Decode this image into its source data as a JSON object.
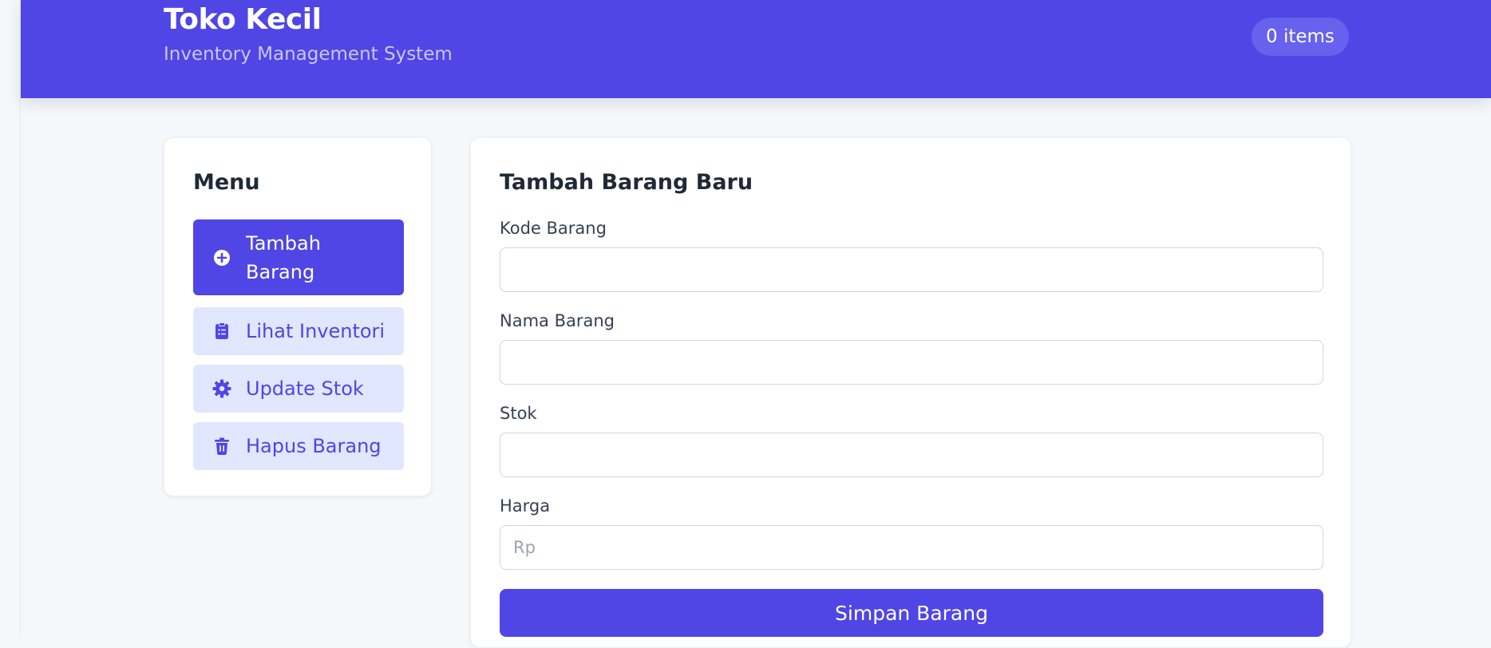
{
  "header": {
    "title": "Toko Kecil",
    "subtitle": "Inventory Management System",
    "item_count": "0 items",
    "brand_color": "#4f46e5"
  },
  "menu": {
    "title": "Menu",
    "items": [
      {
        "label": "Tambah Barang",
        "icon": "plus-circle-icon",
        "active": true
      },
      {
        "label": "Lihat Inventori",
        "icon": "clipboard-list-icon",
        "active": false
      },
      {
        "label": "Update Stok",
        "icon": "gear-icon",
        "active": false
      },
      {
        "label": "Hapus Barang",
        "icon": "trash-icon",
        "active": false
      }
    ]
  },
  "form": {
    "title": "Tambah Barang Baru",
    "fields": [
      {
        "label": "Kode Barang",
        "value": "",
        "placeholder": ""
      },
      {
        "label": "Nama Barang",
        "value": "",
        "placeholder": ""
      },
      {
        "label": "Stok",
        "value": "",
        "placeholder": ""
      },
      {
        "label": "Harga",
        "value": "",
        "placeholder": "Rp"
      }
    ],
    "submit_label": "Simpan Barang"
  }
}
